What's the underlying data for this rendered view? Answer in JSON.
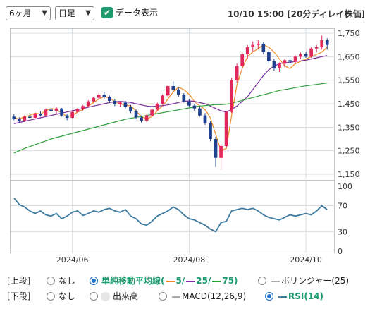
{
  "toolbar": {
    "period_value": "6ヶ月",
    "interval_value": "日足",
    "data_display_label": "データ表示",
    "timestamp": "10/10 15:00 [20分ディレイ株価]"
  },
  "colors": {
    "up_candle": "#e0285a",
    "down_candle": "#1f3f8f",
    "ma5": "#f08a24",
    "ma25": "#7a2c9e",
    "ma75": "#2e9e3a",
    "rsi": "#3c7aa0",
    "accent": "#1e9b6e"
  },
  "chart_data": [
    {
      "type": "candlestick",
      "y_ticks": [
        "1,750",
        "1,650",
        "1,550",
        "1,450",
        "1,350",
        "1,250",
        "1,150"
      ],
      "ylim": [
        1150,
        1750
      ],
      "x_tick_labels": [
        "2024/06",
        "2024/08",
        "2024/10"
      ],
      "series": [
        {
          "name": "5",
          "values": [
            1390,
            1385,
            1395,
            1400,
            1410,
            1405,
            1420,
            1430,
            1425,
            1410,
            1395,
            1400,
            1415,
            1425,
            1440,
            1455,
            1470,
            1480,
            1475,
            1460,
            1450,
            1445,
            1440,
            1420,
            1395,
            1385,
            1395,
            1420,
            1440,
            1470,
            1500,
            1520,
            1510,
            1490,
            1460,
            1440,
            1425,
            1390,
            1320,
            1250,
            1260,
            1400,
            1530,
            1600,
            1650,
            1670,
            1685,
            1700,
            1690,
            1670,
            1640,
            1610,
            1600,
            1620,
            1630,
            1640,
            1650,
            1660,
            1670,
            1690
          ]
        },
        {
          "name": "25",
          "values": [
            1365,
            1370,
            1375,
            1380,
            1385,
            1390,
            1395,
            1400,
            1405,
            1410,
            1415,
            1420,
            1425,
            1430,
            1435,
            1440,
            1445,
            1450,
            1455,
            1458,
            1460,
            1458,
            1455,
            1450,
            1445,
            1440,
            1438,
            1440,
            1442,
            1445,
            1450,
            1455,
            1460,
            1462,
            1460,
            1455,
            1450,
            1440,
            1430,
            1420,
            1415,
            1425,
            1440,
            1460,
            1480,
            1510,
            1540,
            1570,
            1595,
            1610,
            1620,
            1625,
            1625,
            1630,
            1632,
            1635,
            1640,
            1645,
            1650,
            1655
          ]
        },
        {
          "name": "75",
          "values": [
            1240,
            1250,
            1260,
            1268,
            1276,
            1284,
            1292,
            1300,
            1306,
            1312,
            1318,
            1324,
            1330,
            1336,
            1342,
            1348,
            1354,
            1360,
            1366,
            1372,
            1378,
            1384,
            1388,
            1392,
            1396,
            1400,
            1404,
            1408,
            1412,
            1416,
            1420,
            1424,
            1428,
            1432,
            1436,
            1440,
            1442,
            1444,
            1446,
            1446,
            1448,
            1452,
            1458,
            1464,
            1470,
            1476,
            1482,
            1488,
            1494,
            1500,
            1506,
            1510,
            1514,
            1518,
            1522,
            1526,
            1529,
            1532,
            1535,
            1538
          ]
        }
      ],
      "candles": [
        [
          1395,
          1405,
          1380,
          1385
        ],
        [
          1385,
          1392,
          1370,
          1378
        ],
        [
          1378,
          1400,
          1372,
          1395
        ],
        [
          1395,
          1410,
          1385,
          1390
        ],
        [
          1390,
          1412,
          1388,
          1408
        ],
        [
          1408,
          1418,
          1395,
          1400
        ],
        [
          1400,
          1430,
          1398,
          1425
        ],
        [
          1425,
          1440,
          1415,
          1420
        ],
        [
          1420,
          1435,
          1405,
          1430
        ],
        [
          1430,
          1432,
          1395,
          1400
        ],
        [
          1400,
          1405,
          1380,
          1390
        ],
        [
          1390,
          1420,
          1388,
          1415
        ],
        [
          1415,
          1432,
          1410,
          1428
        ],
        [
          1428,
          1445,
          1420,
          1440
        ],
        [
          1440,
          1465,
          1435,
          1460
        ],
        [
          1460,
          1480,
          1455,
          1475
        ],
        [
          1475,
          1495,
          1468,
          1488
        ],
        [
          1488,
          1500,
          1470,
          1478
        ],
        [
          1478,
          1485,
          1455,
          1462
        ],
        [
          1462,
          1470,
          1440,
          1448
        ],
        [
          1448,
          1460,
          1435,
          1455
        ],
        [
          1455,
          1462,
          1430,
          1438
        ],
        [
          1438,
          1445,
          1410,
          1418
        ],
        [
          1418,
          1425,
          1385,
          1392
        ],
        [
          1392,
          1400,
          1370,
          1378
        ],
        [
          1378,
          1405,
          1372,
          1400
        ],
        [
          1400,
          1430,
          1395,
          1425
        ],
        [
          1425,
          1455,
          1420,
          1450
        ],
        [
          1450,
          1490,
          1445,
          1485
        ],
        [
          1485,
          1530,
          1480,
          1525
        ],
        [
          1525,
          1545,
          1505,
          1510
        ],
        [
          1510,
          1520,
          1480,
          1488
        ],
        [
          1488,
          1495,
          1455,
          1460
        ],
        [
          1460,
          1470,
          1435,
          1442
        ],
        [
          1442,
          1450,
          1420,
          1430
        ],
        [
          1430,
          1440,
          1395,
          1400
        ],
        [
          1400,
          1410,
          1360,
          1368
        ],
        [
          1368,
          1375,
          1290,
          1300
        ],
        [
          1300,
          1310,
          1180,
          1220
        ],
        [
          1220,
          1280,
          1170,
          1270
        ],
        [
          1270,
          1420,
          1265,
          1415
        ],
        [
          1415,
          1560,
          1410,
          1550
        ],
        [
          1550,
          1620,
          1540,
          1610
        ],
        [
          1610,
          1670,
          1600,
          1660
        ],
        [
          1660,
          1700,
          1640,
          1690
        ],
        [
          1690,
          1715,
          1670,
          1700
        ],
        [
          1700,
          1720,
          1680,
          1705
        ],
        [
          1705,
          1712,
          1660,
          1670
        ],
        [
          1670,
          1680,
          1620,
          1630
        ],
        [
          1630,
          1640,
          1590,
          1600
        ],
        [
          1600,
          1625,
          1585,
          1620
        ],
        [
          1620,
          1640,
          1605,
          1635
        ],
        [
          1635,
          1650,
          1615,
          1628
        ],
        [
          1628,
          1655,
          1620,
          1650
        ],
        [
          1650,
          1668,
          1640,
          1660
        ],
        [
          1660,
          1672,
          1645,
          1650
        ],
        [
          1650,
          1690,
          1645,
          1685
        ],
        [
          1685,
          1700,
          1670,
          1690
        ],
        [
          1690,
          1740,
          1680,
          1720
        ],
        [
          1720,
          1728,
          1680,
          1700
        ]
      ]
    },
    {
      "type": "line",
      "series": [
        {
          "name": "RSI(14)",
          "values": [
            82,
            72,
            68,
            62,
            58,
            62,
            56,
            54,
            58,
            50,
            54,
            60,
            62,
            55,
            58,
            62,
            60,
            64,
            66,
            62,
            60,
            64,
            54,
            50,
            42,
            40,
            46,
            54,
            58,
            62,
            68,
            64,
            56,
            50,
            48,
            44,
            40,
            34,
            30,
            44,
            46,
            62,
            64,
            66,
            64,
            66,
            62,
            56,
            52,
            50,
            48,
            52,
            56,
            54,
            56,
            58,
            56,
            62,
            70,
            64
          ]
        }
      ],
      "y_ticks": [
        "100",
        "70",
        "30",
        "0"
      ],
      "ylim": [
        0,
        100
      ]
    }
  ],
  "legend": {
    "upper_label": "[上段]",
    "lower_label": "[下段]",
    "upper_options": {
      "none": "なし",
      "sma_label": "単純移動平均線(",
      "sma_5": "5",
      "sma_sep1": "/",
      "sma_25": "25",
      "sma_sep2": "/",
      "sma_75": "75",
      "sma_close": ")",
      "bollinger": "ボリンジャー(25)"
    },
    "lower_options": {
      "none": "なし",
      "volume": "出来高",
      "macd": "MACD(12,26,9)",
      "rsi": "RSI(14)"
    }
  }
}
